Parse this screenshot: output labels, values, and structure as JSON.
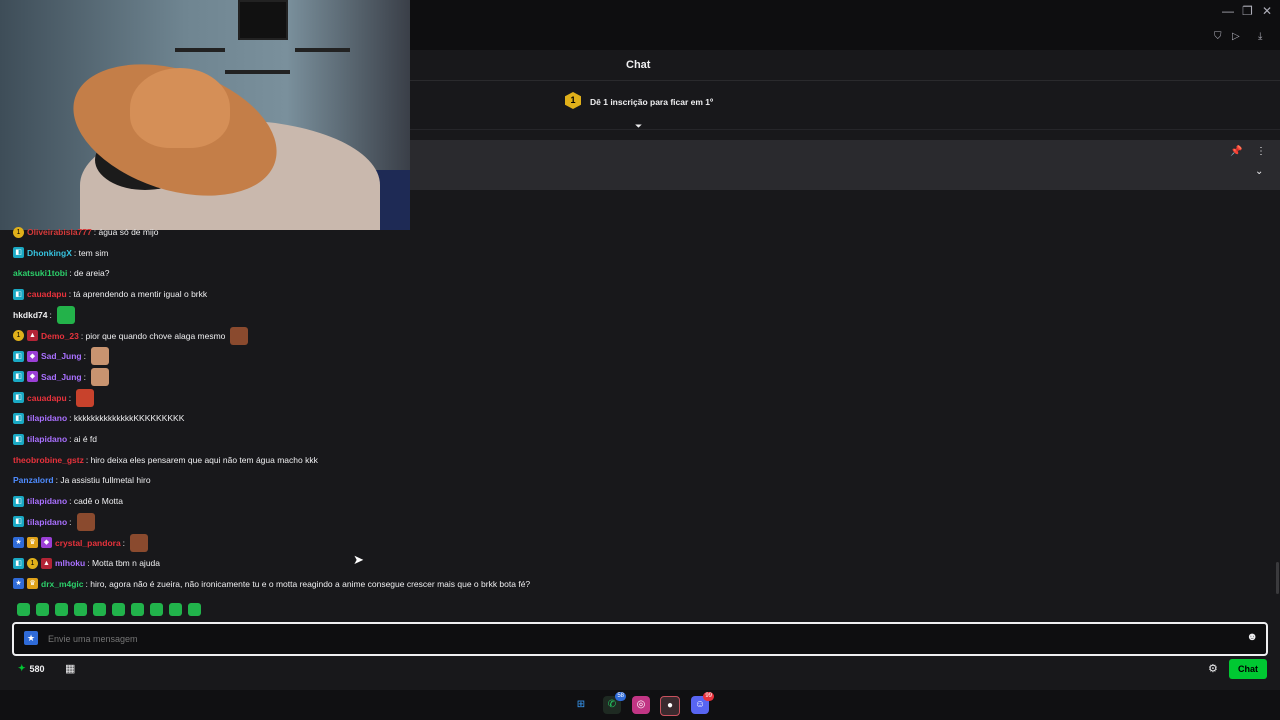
{
  "window": {
    "minimize": "—",
    "restore": "❐",
    "close": "✕"
  },
  "toolbar_icons": [
    "shield-icon",
    "send-icon",
    "download-icon"
  ],
  "chat": {
    "title": "Chat",
    "sub_rank": "1",
    "sub_prompt": "Dê 1 inscrição para ficar em 1º",
    "messages": [
      {
        "badges": [
          "gold"
        ],
        "user": "Oliveirabisla777",
        "color": "#d63a3a",
        "text": ": água só de mijo",
        "emote": null
      },
      {
        "badges": [
          "sub"
        ],
        "user": "DhonkingX",
        "color": "#36c3e0",
        "text": ": tem sim",
        "emote": null
      },
      {
        "badges": [],
        "user": "akatsuki1tobi",
        "color": "#2ccf6a",
        "text": ": de areia?",
        "emote": null
      },
      {
        "badges": [
          "sub"
        ],
        "user": "cauadapu",
        "color": "#e8323c",
        "text": ": tá aprendendo a mentir igual o brkk",
        "emote": null
      },
      {
        "badges": [],
        "user": "hkdkd74",
        "color": "#efeff1",
        "text": ":",
        "emote": "#23b24a"
      },
      {
        "badges": [
          "gold",
          "red"
        ],
        "user": "Demo_23",
        "color": "#e8323c",
        "text": ": pior que quando chove alaga mesmo",
        "emote": "#8a4a2e"
      },
      {
        "badges": [
          "sub",
          "vip"
        ],
        "user": "Sad_Jung",
        "color": "#a970ff",
        "text": ":",
        "emote": "#c99470"
      },
      {
        "badges": [
          "sub",
          "vip"
        ],
        "user": "Sad_Jung",
        "color": "#a970ff",
        "text": ":",
        "emote": "#c99470"
      },
      {
        "badges": [
          "sub"
        ],
        "user": "cauadapu",
        "color": "#e8323c",
        "text": ":",
        "emote": "#c8422c"
      },
      {
        "badges": [
          "sub"
        ],
        "user": "tilapidano",
        "color": "#a970ff",
        "text": ": kkkkkkkkkkkkkkKKKKKKKKK",
        "emote": null
      },
      {
        "badges": [
          "sub"
        ],
        "user": "tilapidano",
        "color": "#a970ff",
        "text": ": ai é fd",
        "emote": null
      },
      {
        "badges": [],
        "user": "theobrobine_gstz",
        "color": "#e8323c",
        "text": ": hiro deixa eles pensarem que aqui não tem água macho kkk",
        "emote": null
      },
      {
        "badges": [],
        "user": "Panzalord",
        "color": "#4f8cff",
        "text": ": Ja assistiu fullmetal hiro",
        "emote": null
      },
      {
        "badges": [
          "sub"
        ],
        "user": "tilapidano",
        "color": "#a970ff",
        "text": ": cadê o Motta",
        "emote": null
      },
      {
        "badges": [
          "sub"
        ],
        "user": "tilapidano",
        "color": "#a970ff",
        "text": ":",
        "emote": "#8a4a2e"
      },
      {
        "badges": [
          "prime",
          "crown",
          "vip"
        ],
        "user": "crystal_pandora",
        "color": "#e8323c",
        "text": ":",
        "emote": "#8a4a2e"
      },
      {
        "badges": [
          "sub",
          "gold",
          "red"
        ],
        "user": "mlhoku",
        "color": "#a970ff",
        "text": ": Motta tbm n ajuda",
        "emote": null
      },
      {
        "badges": [
          "prime",
          "crown"
        ],
        "user": "drx_m4gic",
        "color": "#2ccf6a",
        "text": ": hiro, agora não é zueira, não ironicamente tu e o motta reagindo a anime consegue crescer mais que o brkk bota fé?",
        "emote": null
      }
    ],
    "input_placeholder": "Envie uma mensagem",
    "points": "580",
    "send_label": "Chat"
  },
  "taskbar": {
    "discord_badge": "99",
    "whatsapp_badge": "58"
  }
}
